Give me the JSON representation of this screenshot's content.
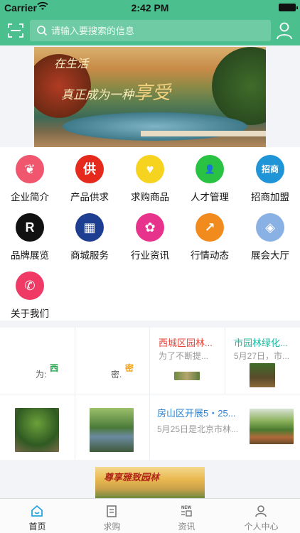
{
  "status_bar": {
    "carrier": "Carrier",
    "time": "2:42 PM"
  },
  "header": {
    "search_placeholder": "请输入要搜索的信息"
  },
  "banner": {
    "line1": "在生活",
    "line2_prefix": "真正成为一种",
    "line2_big": "享受"
  },
  "grid_items": [
    {
      "label": "企业简介",
      "icon": "butterfly-icon",
      "glyph": "❦",
      "color": "#f0566e"
    },
    {
      "label": "产品供求",
      "icon": "supply-icon",
      "glyph": "供",
      "color": "#e5291c"
    },
    {
      "label": "求购商品",
      "icon": "heart-icon",
      "glyph": "♥",
      "color": "#f6d31e"
    },
    {
      "label": "人才管理",
      "icon": "person-icon",
      "glyph": "👤",
      "color": "#2ac242"
    },
    {
      "label": "招商加盟",
      "icon": "investment-icon",
      "glyph": "招商",
      "color": "#1f94d6"
    },
    {
      "label": "品牌展览",
      "icon": "registered-icon",
      "glyph": "R",
      "color": "#111111"
    },
    {
      "label": "商城服务",
      "icon": "store-icon",
      "glyph": "▦",
      "color": "#1e3f91"
    },
    {
      "label": "行业资讯",
      "icon": "aperture-icon",
      "glyph": "✿",
      "color": "#e8338d"
    },
    {
      "label": "行情动态",
      "icon": "trend-chart-icon",
      "glyph": "↗",
      "color": "#f28b1e"
    },
    {
      "label": "展会大厅",
      "icon": "diamond-icon",
      "glyph": "◈",
      "color": "#8ab1e4"
    },
    {
      "label": "关于我们",
      "icon": "phone-icon",
      "glyph": "✆",
      "color": "#ef3a65"
    }
  ],
  "news": {
    "left_items": [
      {
        "frag": "为:",
        "tag": "西",
        "tag_color": "#27a34a"
      },
      {
        "frag": "密.",
        "tag": "密",
        "tag_color": "#f0a21c"
      }
    ],
    "top_items": [
      {
        "title": "西城区园林...",
        "subtitle": "为了不断提...",
        "title_color": "#e6453a"
      },
      {
        "title": "市园林绿化...",
        "subtitle": "5月27日，市...",
        "title_color": "#1fb89f"
      }
    ],
    "wide_item": {
      "title": "房山区开展5・25...",
      "subtitle": "5月25日是北京市林...",
      "title_color": "#2b82d0"
    }
  },
  "bottom_banner": {
    "text": "尊享雅致园林"
  },
  "tabs": [
    {
      "label": "首页",
      "icon": "home-icon",
      "active": true
    },
    {
      "label": "求购",
      "icon": "clipboard-icon",
      "active": false
    },
    {
      "label": "资讯",
      "icon": "news-icon",
      "active": false,
      "badge": "NEW"
    },
    {
      "label": "个人中心",
      "icon": "profile-icon",
      "active": false
    }
  ],
  "colors": {
    "brand": "#4cbf8e",
    "tab_active": "#2aa5e0"
  }
}
